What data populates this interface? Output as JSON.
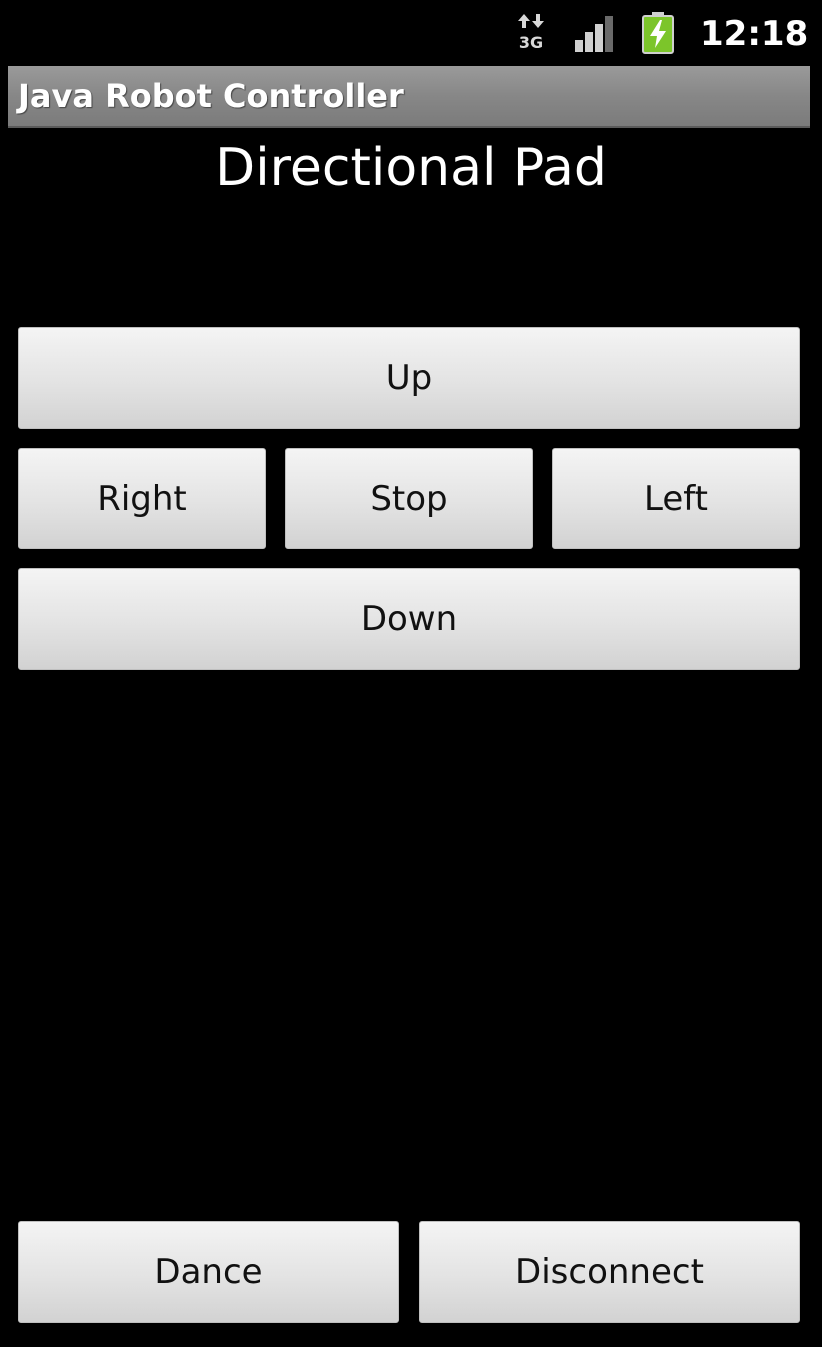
{
  "status_bar": {
    "network_icon": "3g-data-icon",
    "network_label": "3G",
    "signal_icon": "signal-strength-icon",
    "battery_icon": "battery-charging-icon",
    "time": "12:18"
  },
  "app": {
    "title": "Java Robot Controller"
  },
  "main": {
    "heading": "Directional Pad",
    "buttons": {
      "up": "Up",
      "right": "Right",
      "stop": "Stop",
      "left": "Left",
      "down": "Down"
    }
  },
  "footer": {
    "dance": "Dance",
    "disconnect": "Disconnect"
  },
  "colors": {
    "background": "#000000",
    "title_bar": "#8a8a8a",
    "button": "#e3e3e3",
    "battery_accent": "#7cc52a"
  }
}
